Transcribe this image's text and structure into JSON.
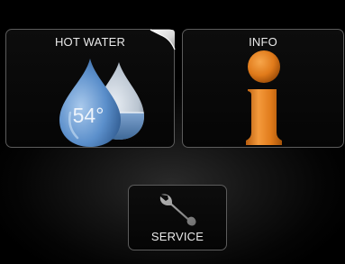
{
  "tiles": {
    "hot_water": {
      "label": "HOT WATER",
      "temperature": "54°",
      "icon": "water-drops-icon"
    },
    "info": {
      "label": "INFO",
      "icon": "info-icon"
    },
    "service": {
      "label": "SERVICE",
      "icon": "wrench-icon"
    }
  },
  "colors": {
    "background": "#000000",
    "tile_border": "#5c5c5c",
    "drop_blue": "#4f86c6",
    "info_orange": "#e07a1a",
    "wrench_gray": "#8a8a8a",
    "label_text": "#e9e9e9"
  }
}
